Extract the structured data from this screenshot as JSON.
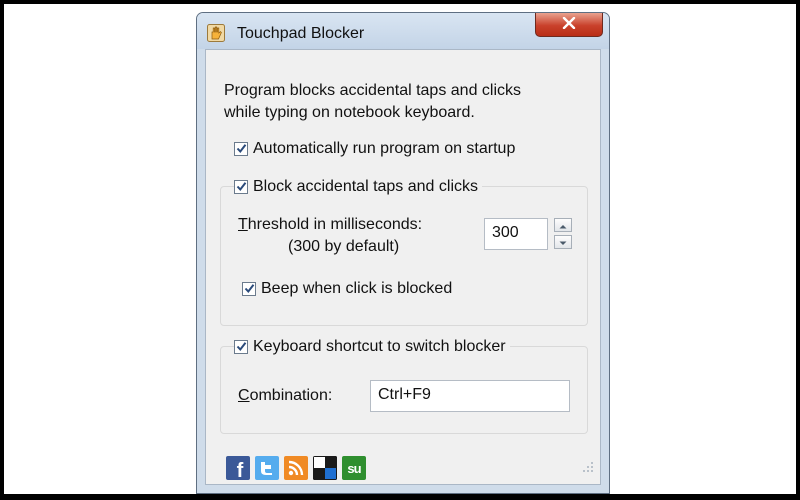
{
  "window": {
    "title": "Touchpad Blocker",
    "close_glyph": "✕"
  },
  "description": "Program blocks accidental taps and clicks\nwhile typing on notebook keyboard.",
  "options": {
    "autorun": {
      "label": "Automatically run program on startup",
      "checked": true
    },
    "block": {
      "label": "Block accidental taps and clicks",
      "checked": true
    },
    "threshold": {
      "label_first": "T",
      "label_rest": "hreshold in milliseconds:",
      "hint": "(300 by default)",
      "value": "300"
    },
    "beep": {
      "label": "Beep when click is blocked",
      "checked": true
    },
    "shortcut": {
      "label": "Keyboard shortcut to switch blocker",
      "checked": true
    },
    "combination": {
      "label_first": "C",
      "label_rest": "ombination:",
      "value": "Ctrl+F9"
    }
  },
  "social": {
    "facebook": "f",
    "stumbleupon": "su"
  },
  "colors": {
    "facebook": "#3b5998",
    "twitter": "#55acee",
    "rss": "#f08a24",
    "delicious": "#1a1a1a",
    "stumbleupon": "#2f8f2f",
    "close": "#c9412b"
  }
}
